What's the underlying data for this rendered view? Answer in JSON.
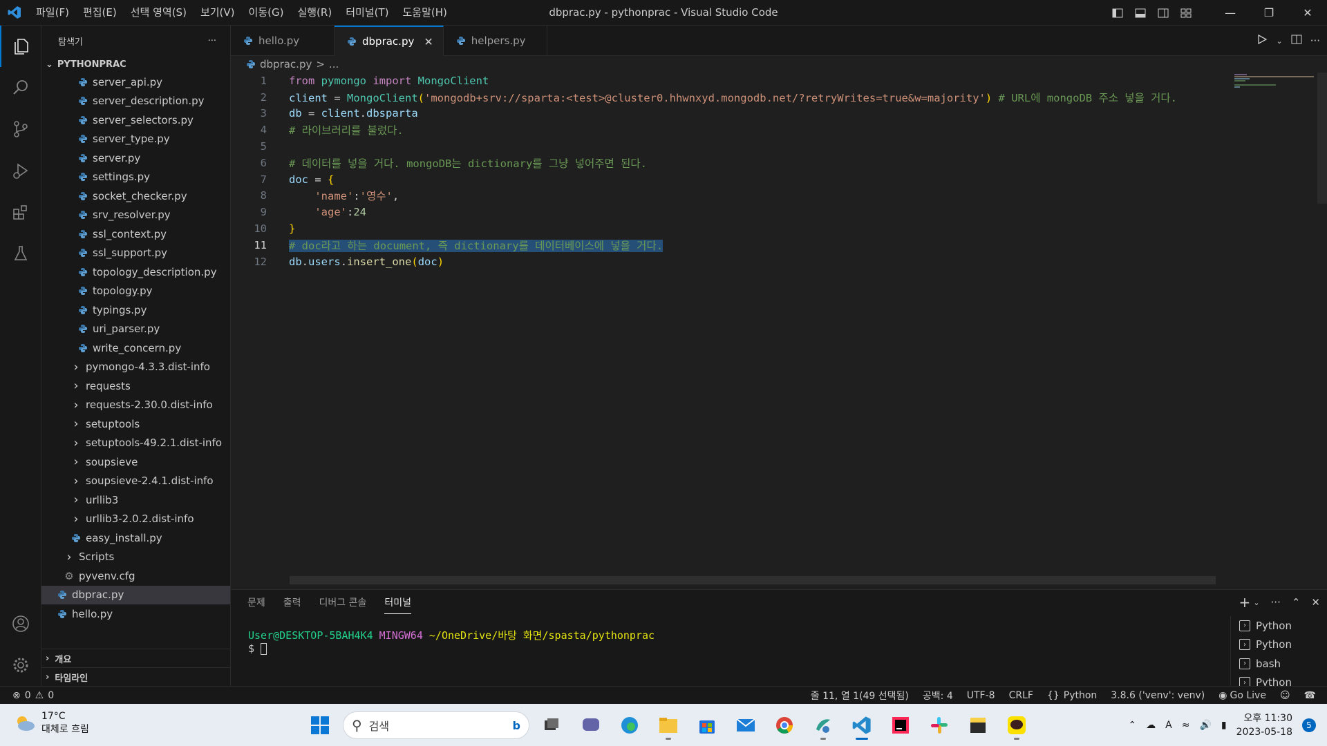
{
  "window": {
    "title": "dbprac.py - pythonprac - Visual Studio Code"
  },
  "menu": [
    "파일(F)",
    "편집(E)",
    "선택 영역(S)",
    "보기(V)",
    "이동(G)",
    "실행(R)",
    "터미널(T)",
    "도움말(H)"
  ],
  "sidebar": {
    "title": "탐색기",
    "more": "···",
    "folder": "PYTHONPRAC",
    "items": [
      {
        "label": "server_api.py",
        "kind": "py",
        "indent": 3
      },
      {
        "label": "server_description.py",
        "kind": "py",
        "indent": 3
      },
      {
        "label": "server_selectors.py",
        "kind": "py",
        "indent": 3
      },
      {
        "label": "server_type.py",
        "kind": "py",
        "indent": 3
      },
      {
        "label": "server.py",
        "kind": "py",
        "indent": 3
      },
      {
        "label": "settings.py",
        "kind": "py",
        "indent": 3
      },
      {
        "label": "socket_checker.py",
        "kind": "py",
        "indent": 3
      },
      {
        "label": "srv_resolver.py",
        "kind": "py",
        "indent": 3
      },
      {
        "label": "ssl_context.py",
        "kind": "py",
        "indent": 3
      },
      {
        "label": "ssl_support.py",
        "kind": "py",
        "indent": 3
      },
      {
        "label": "topology_description.py",
        "kind": "py",
        "indent": 3
      },
      {
        "label": "topology.py",
        "kind": "py",
        "indent": 3
      },
      {
        "label": "typings.py",
        "kind": "py",
        "indent": 3
      },
      {
        "label": "uri_parser.py",
        "kind": "py",
        "indent": 3
      },
      {
        "label": "write_concern.py",
        "kind": "py",
        "indent": 3
      },
      {
        "label": "pymongo-4.3.3.dist-info",
        "kind": "folder",
        "indent": 2
      },
      {
        "label": "requests",
        "kind": "folder",
        "indent": 2
      },
      {
        "label": "requests-2.30.0.dist-info",
        "kind": "folder",
        "indent": 2
      },
      {
        "label": "setuptools",
        "kind": "folder",
        "indent": 2
      },
      {
        "label": "setuptools-49.2.1.dist-info",
        "kind": "folder",
        "indent": 2
      },
      {
        "label": "soupsieve",
        "kind": "folder",
        "indent": 2
      },
      {
        "label": "soupsieve-2.4.1.dist-info",
        "kind": "folder",
        "indent": 2
      },
      {
        "label": "urllib3",
        "kind": "folder",
        "indent": 2
      },
      {
        "label": "urllib3-2.0.2.dist-info",
        "kind": "folder",
        "indent": 2
      },
      {
        "label": "easy_install.py",
        "kind": "py",
        "indent": 2
      },
      {
        "label": "Scripts",
        "kind": "folder",
        "indent": 1
      },
      {
        "label": "pyvenv.cfg",
        "kind": "cfg",
        "indent": 1
      },
      {
        "label": "dbprac.py",
        "kind": "py",
        "indent": 0,
        "selected": true
      },
      {
        "label": "hello.py",
        "kind": "py",
        "indent": 0
      }
    ],
    "outline": "개요",
    "timeline": "타임라인"
  },
  "tabs": [
    {
      "label": "hello.py",
      "active": false
    },
    {
      "label": "dbprac.py",
      "active": true
    },
    {
      "label": "helpers.py",
      "active": false
    }
  ],
  "breadcrumb": {
    "file": "dbprac.py",
    "sep": ">",
    "rest": "..."
  },
  "code": {
    "current_line": 11,
    "lines": [
      [
        {
          "t": "from ",
          "c": "kw"
        },
        {
          "t": "pymongo ",
          "c": "cls"
        },
        {
          "t": "import ",
          "c": "kw"
        },
        {
          "t": "MongoClient",
          "c": "cls"
        }
      ],
      [
        {
          "t": "client ",
          "c": "var"
        },
        {
          "t": "= ",
          "c": "pun"
        },
        {
          "t": "MongoClient",
          "c": "cls"
        },
        {
          "t": "(",
          "c": "br1"
        },
        {
          "t": "'mongodb+srv://sparta:<test>@cluster0.hhwnxyd.mongodb.net/?retryWrites=true&w=majority'",
          "c": "str"
        },
        {
          "t": ")",
          "c": "br1"
        },
        {
          "t": " # URL에 mongoDB 주소 넣을 거다.",
          "c": "cmt"
        }
      ],
      [
        {
          "t": "db ",
          "c": "var"
        },
        {
          "t": "= ",
          "c": "pun"
        },
        {
          "t": "client",
          "c": "var"
        },
        {
          "t": ".",
          "c": "pun"
        },
        {
          "t": "dbsparta",
          "c": "var"
        }
      ],
      [
        {
          "t": "# 라이브러리를 불렀다.",
          "c": "cmt"
        }
      ],
      [],
      [
        {
          "t": "# 데이터를 넣을 거다. mongoDB는 dictionary를 그냥 넣어주면 된다.",
          "c": "cmt"
        }
      ],
      [
        {
          "t": "doc ",
          "c": "var"
        },
        {
          "t": "= ",
          "c": "pun"
        },
        {
          "t": "{",
          "c": "br1"
        }
      ],
      [
        {
          "t": "    ",
          "c": "pun"
        },
        {
          "t": "'name'",
          "c": "str"
        },
        {
          "t": ":",
          "c": "pun"
        },
        {
          "t": "'영수'",
          "c": "str"
        },
        {
          "t": ",",
          "c": "pun"
        }
      ],
      [
        {
          "t": "    ",
          "c": "pun"
        },
        {
          "t": "'age'",
          "c": "str"
        },
        {
          "t": ":",
          "c": "pun"
        },
        {
          "t": "24",
          "c": "num"
        }
      ],
      [
        {
          "t": "}",
          "c": "br1"
        }
      ],
      [
        {
          "t": "# doc라고 하는 document, 즉 dictionary를 데이터베이스에 넣을 거다.",
          "c": "cmt",
          "hl": true
        }
      ],
      [
        {
          "t": "db",
          "c": "var"
        },
        {
          "t": ".",
          "c": "pun"
        },
        {
          "t": "users",
          "c": "var"
        },
        {
          "t": ".",
          "c": "pun"
        },
        {
          "t": "insert_one",
          "c": "fn"
        },
        {
          "t": "(",
          "c": "br1"
        },
        {
          "t": "doc",
          "c": "var"
        },
        {
          "t": ")",
          "c": "br1"
        }
      ]
    ]
  },
  "panel": {
    "tabs": [
      "문제",
      "출력",
      "디버그 콘솔",
      "터미널"
    ],
    "active_tab": "터미널",
    "terminal": {
      "user": "User@DESKTOP-5BAH4K4",
      "shell": "MINGW64",
      "path": "~/OneDrive/바탕 화면/spasta/pythonprac",
      "prompt": "$"
    },
    "terminals": [
      "Python",
      "Python",
      "bash",
      "Python"
    ]
  },
  "status": {
    "errors": "0",
    "warnings": "0",
    "position": "줄 11, 열 1(49 선택됨)",
    "spaces": "공백: 4",
    "encoding": "UTF-8",
    "eol": "CRLF",
    "language": "Python",
    "interpreter": "3.8.6 ('venv': venv)",
    "golive": "Go Live"
  },
  "taskbar": {
    "temp": "17°C",
    "weather": "대체로 흐림",
    "search_placeholder": "검색",
    "time": "오후 11:30",
    "date": "2023-05-18",
    "notifications": "5",
    "apps": [
      "start-icon",
      "search",
      "task-view-icon",
      "chat-icon",
      "edge-icon",
      "file-explorer-icon",
      "store-icon",
      "mail-icon",
      "chrome-icon",
      "python-app-icon",
      "vscode-icon",
      "intellij-icon",
      "slack-icon",
      "sticky-notes-icon",
      "kakaotalk-icon"
    ]
  },
  "colors": {
    "accent": "#0078d4",
    "editor_bg": "#1f1f1f",
    "selection": "#264f78"
  }
}
